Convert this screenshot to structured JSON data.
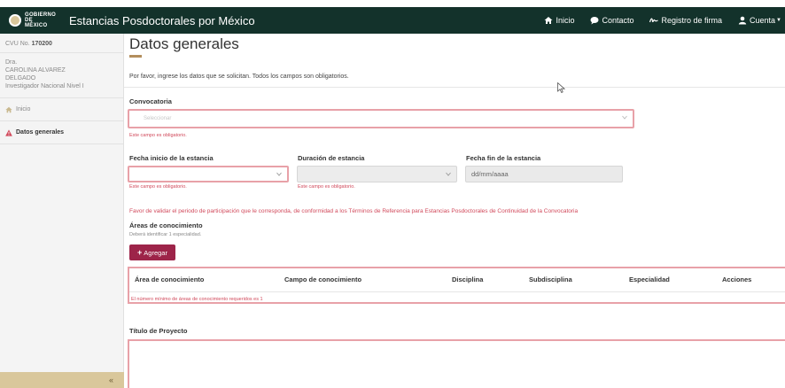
{
  "header": {
    "logo_text": "GOBIERNO DE MÉXICO",
    "brand": "Estancias Posdoctorales por México",
    "nav": [
      {
        "label": "Inicio",
        "icon": "home-icon"
      },
      {
        "label": "Contacto",
        "icon": "chat-bubble-icon"
      },
      {
        "label": "Registro de firma",
        "icon": "signature-icon"
      },
      {
        "label": "Cuenta",
        "icon": "user-icon"
      }
    ]
  },
  "sidebar": {
    "cvu_label": "CVU No.",
    "cvu_number": "170200",
    "user_lines": [
      "Dra.",
      "CAROLINA ALVAREZ",
      "DELGADO",
      "Investigador Nacional Nivel I"
    ],
    "items": [
      {
        "label": "Inicio",
        "icon": "home-icon"
      },
      {
        "label": "Datos generales",
        "icon": "warning-icon"
      }
    ],
    "collapse_glyph": "«"
  },
  "main": {
    "title": "Datos generales",
    "intro": "Por favor, ingrese los datos que se solicitan. Todos los campos son obligatorios.",
    "convocatoria": {
      "label": "Convocatoria",
      "placeholder": "Seleccionar",
      "error": "Este campo es obligatorio."
    },
    "fecha_inicio": {
      "label": "Fecha inicio de la estancia",
      "error": "Este campo es obligatorio."
    },
    "duracion": {
      "label": "Duración de estancia",
      "error": "Este campo es obligatorio."
    },
    "fecha_fin": {
      "label": "Fecha fin de la estancia",
      "placeholder": "dd/mm/aaaa"
    },
    "warning": "Favor de validar el periodo de participación que le corresponda, de conformidad a los Términos de Referencia para Estancias Posdoctorales de Continuidad de la Convocatoria",
    "areas": {
      "label": "Áreas de conocimiento",
      "sublabel": "Deberá identificar 1 especialidad.",
      "add_button": "Agregar",
      "columns": [
        "Área de conocimiento",
        "Campo de conocimiento",
        "Disciplina",
        "Subdisciplina",
        "Especialidad",
        "Acciones"
      ],
      "error": "El número mínimo de áreas de conocimiento requeridos es 1"
    },
    "titulo_proyecto": {
      "label": "Título de Proyecto"
    }
  },
  "colors": {
    "header": "#13322b",
    "accent": "#9d2449",
    "gold": "#b38e5d",
    "error": "#d1495b"
  }
}
